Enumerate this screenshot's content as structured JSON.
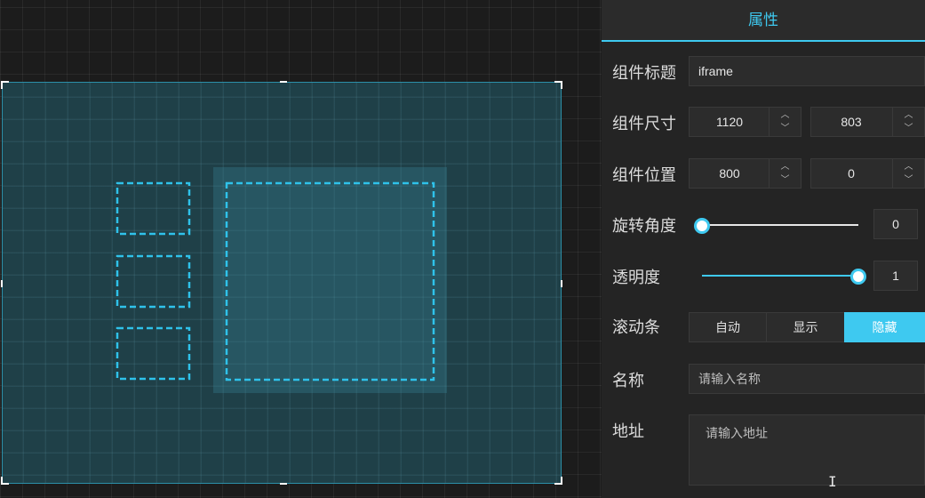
{
  "panel": {
    "title": "属性",
    "component_title": {
      "label": "组件标题",
      "value": "iframe"
    },
    "component_size": {
      "label": "组件尺寸",
      "width": "1120",
      "height": "803"
    },
    "component_position": {
      "label": "组件位置",
      "x": "800",
      "y": "0"
    },
    "rotation": {
      "label": "旋转角度",
      "value": "0",
      "fraction": 0
    },
    "opacity": {
      "label": "透明度",
      "value": "1",
      "fraction": 1
    },
    "scrollbar": {
      "label": "滚动条",
      "options": [
        "自动",
        "显示",
        "隐藏"
      ],
      "selected": "隐藏"
    },
    "name": {
      "label": "名称",
      "placeholder": "请输入名称"
    },
    "address": {
      "label": "地址",
      "placeholder": "请输入地址"
    }
  },
  "icons": {
    "stepper_up": "chevron-up-icon",
    "stepper_down": "chevron-down-icon",
    "text_cursor": "i-beam-cursor-icon"
  },
  "colors": {
    "accent": "#3ec9f0",
    "panel_bg": "#242424",
    "canvas_bg": "#1c1c1c",
    "component_fill": "#235f6e"
  }
}
